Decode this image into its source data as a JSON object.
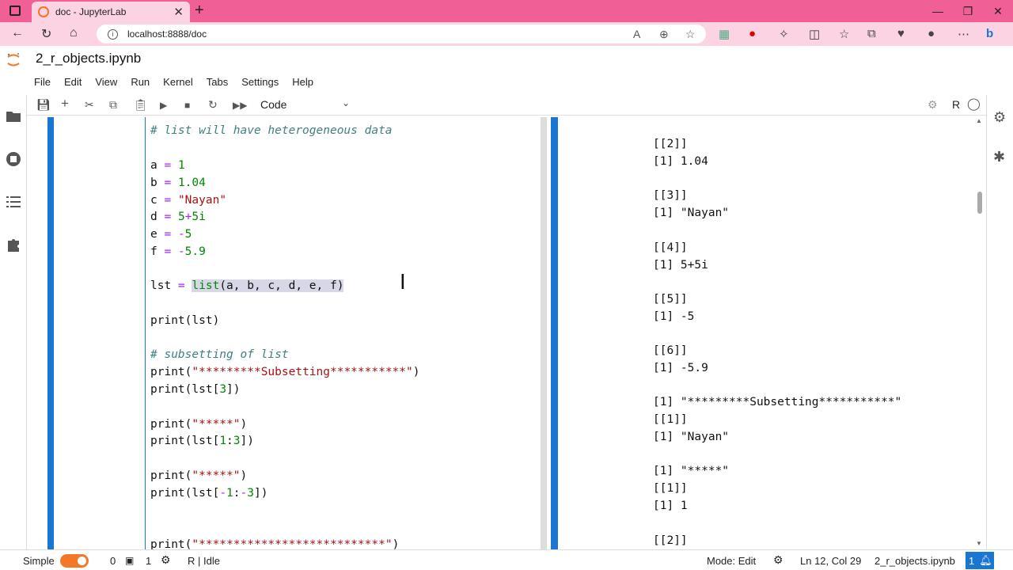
{
  "browser": {
    "tab_title": "doc - JupyterLab",
    "url": "localhost:8888/doc"
  },
  "notebook": {
    "title": "2_r_objects.ipynb"
  },
  "menu": [
    "File",
    "Edit",
    "View",
    "Run",
    "Kernel",
    "Tabs",
    "Settings",
    "Help"
  ],
  "toolbar": {
    "cell_type": "Code",
    "kernel": "R"
  },
  "code_lines": [
    "# list will have heterogeneous data",
    "",
    "a = 1",
    "b = 1.04",
    "c = \"Nayan\"",
    "d = 5+5i",
    "e = -5",
    "f = -5.9",
    "",
    "lst = list(a, b, c, d, e, f)",
    "",
    "print(lst)",
    "",
    "# subsetting of list",
    "print(\"*********Subsetting***********\")",
    "print(lst[3])",
    "",
    "print(\"*****\")",
    "print(lst[1:3])",
    "",
    "print(\"*****\")",
    "print(lst[-1:-3])",
    "",
    "",
    "print(\"***************************\")"
  ],
  "output_lines": [
    "[[2]]",
    "[1] 1.04",
    "",
    "[[3]]",
    "[1] \"Nayan\"",
    "",
    "[[4]]",
    "[1] 5+5i",
    "",
    "[[5]]",
    "[1] -5",
    "",
    "[[6]]",
    "[1] -5.9",
    "",
    "[1] \"*********Subsetting***********\"",
    "[[1]]",
    "[1] \"Nayan\"",
    "",
    "[1] \"*****\"",
    "[[1]]",
    "[1] 1",
    "",
    "[[2]]"
  ],
  "status": {
    "mode_label": "Simple",
    "terminals": "0",
    "kernels": "1",
    "kernel_status": "R | Idle",
    "mode": "Mode: Edit",
    "position": "Ln 12, Col 29",
    "file": "2_r_objects.ipynb",
    "notifications": "1"
  }
}
